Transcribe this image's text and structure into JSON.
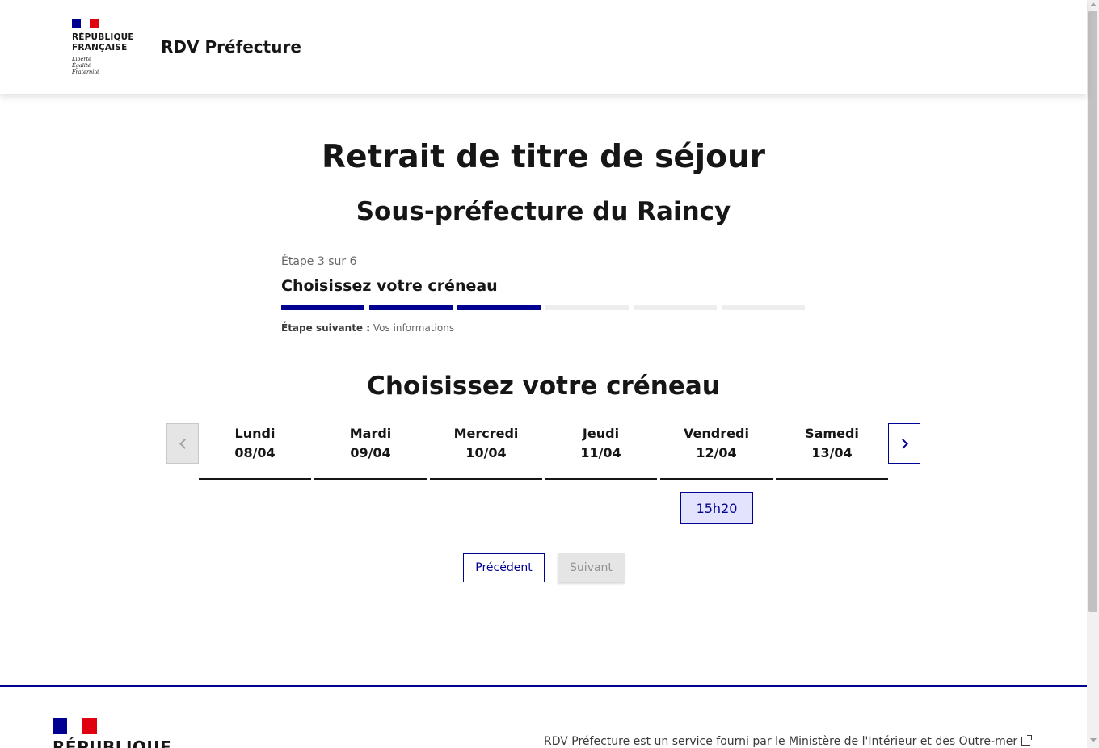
{
  "header": {
    "logo_line1": "RÉPUBLIQUE",
    "logo_line2": "FRANÇAISE",
    "motto1": "Liberté",
    "motto2": "Égalité",
    "motto3": "Fraternité",
    "site_title": "RDV Préfecture"
  },
  "page": {
    "title": "Retrait de titre de séjour",
    "subtitle": "Sous-préfecture du Raincy"
  },
  "stepper": {
    "state": "Étape 3 sur 6",
    "current_title": "Choisissez votre créneau",
    "steps_total": 6,
    "steps_done": 3,
    "next_label": "Étape suivante :",
    "next_value": "Vos informations",
    "color_done": "#000091",
    "color_todo": "#eeeeee"
  },
  "calendar": {
    "title": "Choisissez votre créneau",
    "days": [
      {
        "name": "Lundi",
        "date": "08/04"
      },
      {
        "name": "Mardi",
        "date": "09/04"
      },
      {
        "name": "Mercredi",
        "date": "10/04"
      },
      {
        "name": "Jeudi",
        "date": "11/04"
      },
      {
        "name": "Vendredi",
        "date": "12/04"
      },
      {
        "name": "Samedi",
        "date": "13/04"
      }
    ],
    "slots": [
      {
        "day": "Vendredi",
        "time": "15h20"
      }
    ]
  },
  "nav": {
    "prev_label": "Précédent",
    "next_label": "Suivant"
  },
  "footer": {
    "logo_line1": "RÉPUBLIQUE",
    "text": "RDV Préfecture est un service fourni par le Ministère de l'Intérieur et des Outre-mer"
  }
}
